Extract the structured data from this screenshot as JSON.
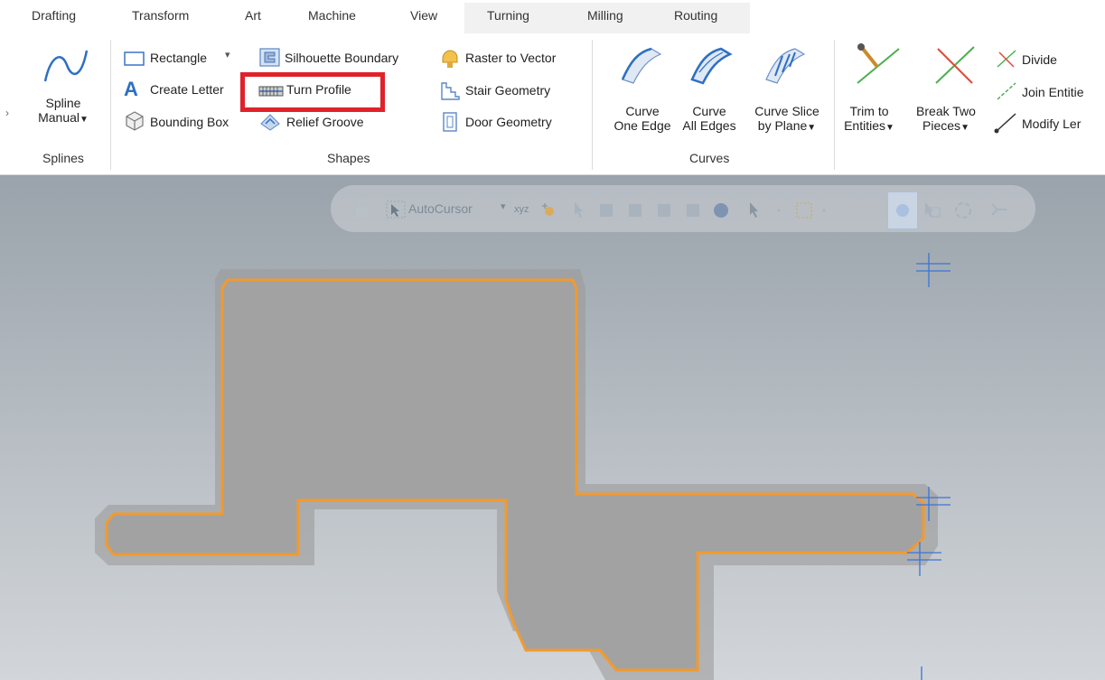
{
  "tabs": [
    "Drafting",
    "Transform",
    "Art",
    "Machine",
    "View",
    "Turning",
    "Milling",
    "Routing"
  ],
  "splines": {
    "spline_manual": [
      "Spline",
      "Manual"
    ],
    "group_label": "Splines"
  },
  "shapes": {
    "rectangle": "Rectangle",
    "create_letter": "Create Letter",
    "bounding_box": "Bounding Box",
    "silhouette_boundary": "Silhouette Boundary",
    "turn_profile": "Turn Profile",
    "relief_groove": "Relief Groove",
    "raster_to_vector": "Raster to Vector",
    "stair_geometry": "Stair Geometry",
    "door_geometry": "Door Geometry",
    "group_label": "Shapes"
  },
  "curves": {
    "curve_one_edge": [
      "Curve",
      "One Edge"
    ],
    "curve_all_edges": [
      "Curve",
      "All Edges"
    ],
    "curve_slice_by_plane": [
      "Curve Slice",
      "by Plane"
    ],
    "group_label": "Curves"
  },
  "edit": {
    "trim_to_entities": [
      "Trim to",
      "Entities"
    ],
    "break_two_pieces": [
      "Break Two",
      "Pieces"
    ],
    "divide": "Divide",
    "join_entities": "Join Entitie",
    "modify_length": "Modify Ler"
  },
  "toolbar": {
    "autocursor": "AutoCursor",
    "xyz": "xyz"
  },
  "colors": {
    "profile_fill": "#a2a2a2",
    "profile_outline": "#f29a2e",
    "highlight_box": "#e0222a",
    "cursor_marker": "#3a74d6"
  }
}
